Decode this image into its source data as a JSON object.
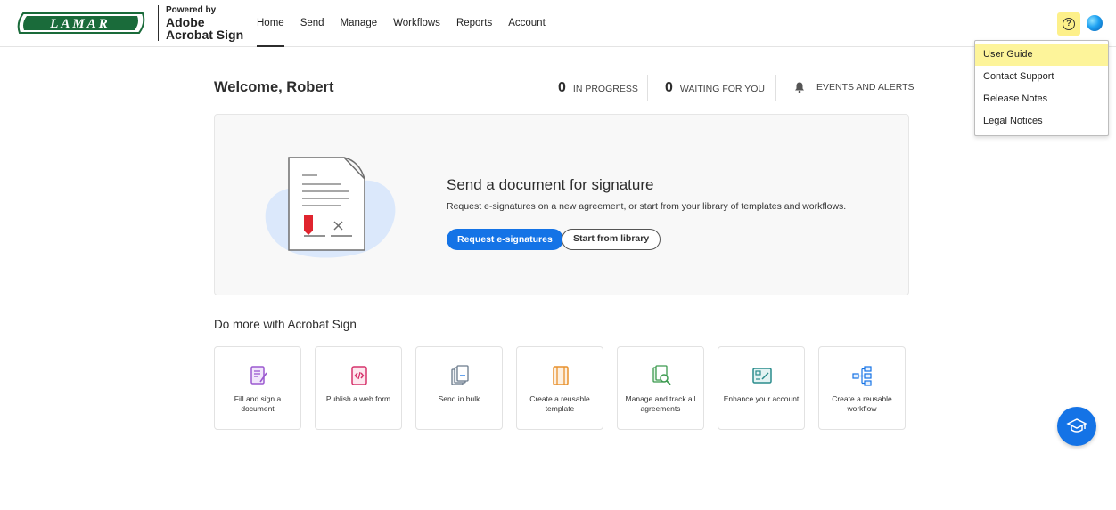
{
  "brand": {
    "logo_text": "LAMAR",
    "powered_by": "Powered by",
    "product": "Adobe Acrobat Sign",
    "logo_color": "#1a6b3a"
  },
  "nav": {
    "items": [
      {
        "label": "Home",
        "active": true
      },
      {
        "label": "Send",
        "active": false
      },
      {
        "label": "Manage",
        "active": false
      },
      {
        "label": "Workflows",
        "active": false
      },
      {
        "label": "Reports",
        "active": false
      },
      {
        "label": "Account",
        "active": false
      }
    ]
  },
  "header_icons": {
    "help": "help-icon",
    "avatar": "user-avatar",
    "help_highlight_color": "#fdf08a"
  },
  "help_menu": {
    "items": [
      {
        "label": "User Guide",
        "highlighted": true
      },
      {
        "label": "Contact Support",
        "highlighted": false
      },
      {
        "label": "Release Notes",
        "highlighted": false
      },
      {
        "label": "Legal Notices",
        "highlighted": false
      }
    ]
  },
  "welcome": {
    "greeting": "Welcome, Robert",
    "in_progress_count": "0",
    "in_progress_label": "IN PROGRESS",
    "waiting_count": "0",
    "waiting_label": "WAITING FOR YOU",
    "events_label": "EVENTS AND ALERTS"
  },
  "hero": {
    "title": "Send a document for signature",
    "description": "Request e-signatures on a new agreement, or start from your library of templates and workflows.",
    "primary_button": "Request e-signatures",
    "secondary_button": "Start from library",
    "accent_color": "#1473e6"
  },
  "do_more": {
    "title": "Do more with Acrobat Sign",
    "tiles": [
      {
        "label": "Fill and sign a document",
        "icon": "fill-sign-icon",
        "color": "#9b59d0"
      },
      {
        "label": "Publish a web form",
        "icon": "web-form-icon",
        "color": "#d6336c"
      },
      {
        "label": "Send in bulk",
        "icon": "bulk-send-icon",
        "color": "#6b7b8c"
      },
      {
        "label": "Create a reusable template",
        "icon": "template-icon",
        "color": "#e8912d"
      },
      {
        "label": "Manage and track all agreements",
        "icon": "manage-track-icon",
        "color": "#3c9a4f"
      },
      {
        "label": "Enhance your account",
        "icon": "enhance-account-icon",
        "color": "#2a8c8c"
      },
      {
        "label": "Create a reusable workflow",
        "icon": "workflow-icon",
        "color": "#1473e6"
      }
    ]
  },
  "learn_button": {
    "icon": "graduation-cap-icon"
  }
}
